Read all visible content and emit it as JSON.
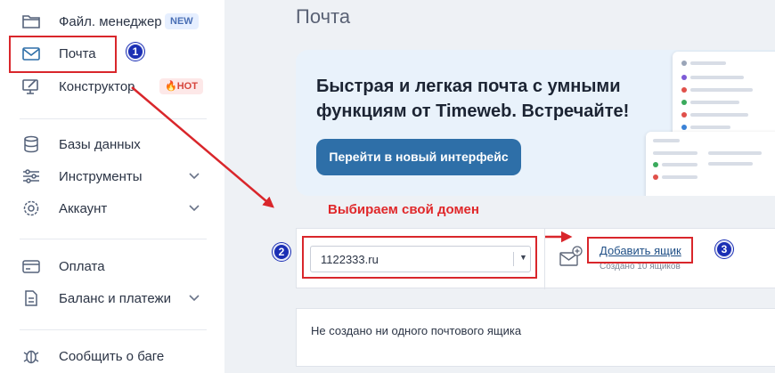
{
  "sidebar": {
    "items": [
      {
        "label": "Файл. менеджер",
        "icon": "folder-icon",
        "badge": "NEW"
      },
      {
        "label": "Почта",
        "icon": "mail-icon"
      },
      {
        "label": "Конструктор",
        "icon": "monitor-brush-icon",
        "badge": "HOT"
      },
      {
        "label": "Базы данных",
        "icon": "database-icon"
      },
      {
        "label": "Инструменты",
        "icon": "sliders-icon"
      },
      {
        "label": "Аккаунт",
        "icon": "gear-icon"
      },
      {
        "label": "Оплата",
        "icon": "credit-card-icon"
      },
      {
        "label": "Баланс и платежи",
        "icon": "document-icon"
      },
      {
        "label": "Сообщить о баге",
        "icon": "bug-icon"
      }
    ]
  },
  "page": {
    "title": "Почта"
  },
  "banner": {
    "text": "Быстрая и легкая почта с умными функциям от Timeweb. Встречайте!",
    "button": "Перейти в новый интерфейс"
  },
  "annotation": {
    "label": "Выбираем свой домен",
    "steps": [
      "1",
      "2",
      "3"
    ]
  },
  "domain": {
    "selected": "1122333.ru",
    "add_mailbox": "Добавить ящик",
    "created_count": "Создано 10 ящиков"
  },
  "mailboxes": {
    "empty_message": "Не создано ни одного почтового ящика"
  },
  "colors": {
    "accent": "#2e6fa8",
    "annotation_red": "#d9262b",
    "step_blue": "#1b2fb4"
  }
}
